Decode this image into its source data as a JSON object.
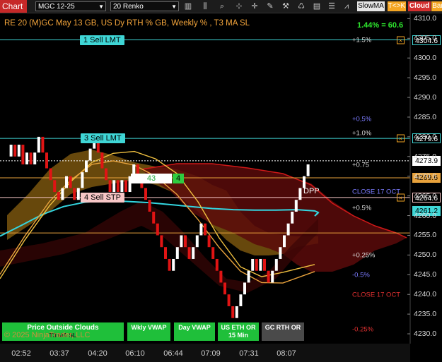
{
  "toolbar": {
    "chart_label": "Chart",
    "instrument": "MGC 12-25",
    "bar_type": "20 Renko",
    "indicator_btn": "SlowMA",
    "tk_btn": "T<>K",
    "cloud_btn": "Cloud",
    "bar_btn": "Bar",
    "colors": {
      "chart_red": "#c62828",
      "tk_orange": "#f5a623",
      "cloud_red": "#d32f2f"
    }
  },
  "chart_title": "RE 20  (M)GC May 13 GB, US Dy RTH % GB, Weekly % , T3 MA SL",
  "calc_text": "1.44% = 60.6",
  "copyright": "© 2025 NinjaTrader, LLC",
  "bottom_buttons": [
    {
      "label": "Price Outside Clouds",
      "sublabel": "T3 MA SL"
    },
    {
      "label": "Wkly VWAP",
      "sublabel": ""
    },
    {
      "label": "Day VWAP",
      "sublabel": ""
    },
    {
      "label": "US ETH OR 15 Min",
      "sublabel": ""
    },
    {
      "label": "GC RTH OR",
      "sublabel": ""
    }
  ],
  "counters": {
    "left": "43",
    "right": "4"
  },
  "orders": [
    {
      "label": "1 Sell LMT",
      "price": 4304.6,
      "price_text": "4304.6",
      "color": "#3fd6d6"
    },
    {
      "label": "3 Sell LMT",
      "price": 4279.6,
      "price_text": "4279.6",
      "color": "#3fd6d6"
    },
    {
      "label": "4 Sell STP",
      "price": 4264.6,
      "price_text": "4264.6",
      "color": "#f7c6c6"
    }
  ],
  "price_tags": [
    {
      "text": "4273.9",
      "price": 4273.9,
      "bg": "#ffffff",
      "fg": "#000000"
    },
    {
      "text": "4269.6",
      "price": 4269.6,
      "bg": "#e8a23c",
      "fg": "#000000"
    },
    {
      "text": "4261.2",
      "price": 4261.2,
      "bg": "#3fd6d6",
      "fg": "#000000"
    }
  ],
  "pct_labels": [
    {
      "text": "+1.5%",
      "price": 4304.6,
      "color": "#dddddd"
    },
    {
      "text": "+0,5%",
      "price": 4284.4,
      "color": "#7b7bff"
    },
    {
      "text": "+1.0%",
      "price": 4280.9,
      "color": "#dddddd"
    },
    {
      "text": "+0.75",
      "price": 4272.9,
      "color": "#dddddd"
    },
    {
      "text": "CLOSE 17 OCT",
      "price": 4266.0,
      "color": "#7b7bff"
    },
    {
      "text": "+0.5%",
      "price": 4261.8,
      "color": "#dddddd"
    },
    {
      "text": "+0.25%",
      "price": 4249.9,
      "color": "#dddddd"
    },
    {
      "text": "-0.5%",
      "price": 4244.9,
      "color": "#7b7bff"
    },
    {
      "text": "CLOSE 17 OCT",
      "price": 4239.9,
      "color": "#e03030"
    },
    {
      "text": "-0.25%",
      "price": 4231.0,
      "color": "#e03030"
    }
  ],
  "dpp_label": "DPP",
  "chart_data": {
    "type": "line",
    "title": "RE 20  (M)GC May 13 GB, US Dy RTH % GB, Weekly % , T3 MA SL",
    "ylim": [
      4227.5,
      4311.5
    ],
    "y_ticks": [
      4310.0,
      4305.0,
      4300.0,
      4295.0,
      4290.0,
      4285.0,
      4280.0,
      4275.0,
      4270.0,
      4265.0,
      4260.0,
      4255.0,
      4250.0,
      4245.0,
      4240.0,
      4235.0,
      4230.0
    ],
    "x_ticks": [
      "02:52",
      "03:37",
      "04:20",
      "06:10",
      "06:44",
      "07:09",
      "07:31",
      "08:07"
    ],
    "horizontal_lines": [
      {
        "name": "1 Sell LMT",
        "value": 4304.6
      },
      {
        "name": "3 Sell LMT",
        "value": 4279.6
      },
      {
        "name": "",
        "value": 4273.9
      },
      {
        "name": "",
        "value": 4269.6
      },
      {
        "name": "",
        "value": 4264.6
      },
      {
        "name": "",
        "value": 4255.6
      }
    ],
    "renko_closes": [
      4275,
      4278,
      4275,
      4278,
      4273,
      4276,
      4273,
      4276,
      4280,
      4276,
      4272,
      4269,
      4266,
      4264,
      4267,
      4270,
      4267,
      4264,
      4267,
      4271,
      4274,
      4277,
      4280,
      4276,
      4272,
      4269,
      4266,
      4269,
      4266,
      4269,
      4266,
      4270,
      4273,
      4270,
      4267,
      4264,
      4261,
      4258,
      4255,
      4252,
      4249,
      4246,
      4249,
      4252,
      4255,
      4252,
      4249,
      4252,
      4255,
      4258,
      4255,
      4252,
      4249,
      4246,
      4243,
      4240,
      4237,
      4234,
      4237,
      4240,
      4243,
      4246,
      4249,
      4246,
      4249,
      4246,
      4243,
      4246,
      4249,
      4252,
      4255,
      4258,
      4261,
      4264,
      4267,
      4270,
      4273
    ],
    "series": [
      {
        "name": "",
        "values": [
          4254.8,
          4257.5,
          4260.3,
          4262.3,
          4263.4,
          4263.8,
          4263.6,
          4263.3,
          4262.8,
          4262.3,
          4261.8,
          4261.5,
          4261.4,
          4261.4,
          4261.5,
          4261.2,
          4260.8,
          4259.9,
          4260.7
        ]
      },
      {
        "name": "",
        "values": [
          4244.0,
          4253.8,
          4262.5,
          4268.6,
          4273.5,
          4275.8,
          4276.3,
          4274.4,
          4270.7,
          4263.5,
          4254.3,
          4247.0,
          4244.5,
          4245.6,
          4247.6
        ]
      },
      {
        "name": "",
        "values": [
          4245.1,
          4254.8,
          4263.6,
          4269.0,
          4273.0,
          4273.9,
          4272.8,
          4270.0,
          4265.4,
          4259.0,
          4251.9,
          4245.9,
          4243.0,
          4242.9,
          4245.8
        ]
      }
    ]
  }
}
